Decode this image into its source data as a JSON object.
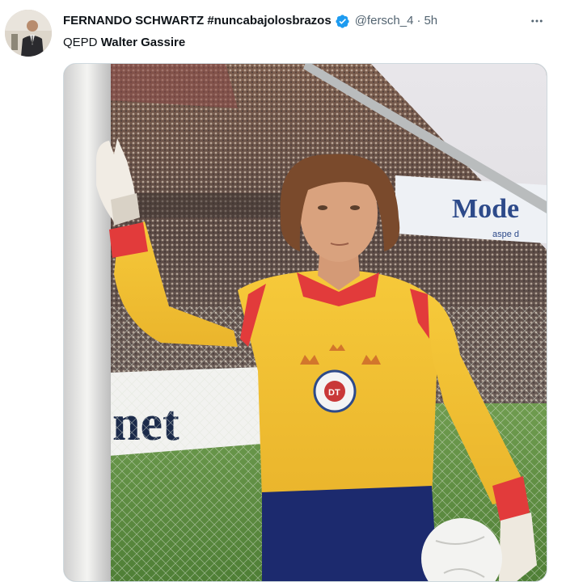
{
  "tweet": {
    "author_name": "FERNANDO SCHWARTZ #nuncabajolosbrazos",
    "handle": "@fersch_4",
    "separator": "·",
    "time": "5h",
    "text_prefix": "QEPD",
    "text_bold": "Walter Gassire",
    "verified_color": "#1d9bf0",
    "avatar_icon": "profile-photo",
    "more_icon": "more-horizontal-icon"
  },
  "media": {
    "banner_left_text": "net",
    "banner_right_text": "Mode",
    "banner_right_subtext": "aspe d"
  }
}
